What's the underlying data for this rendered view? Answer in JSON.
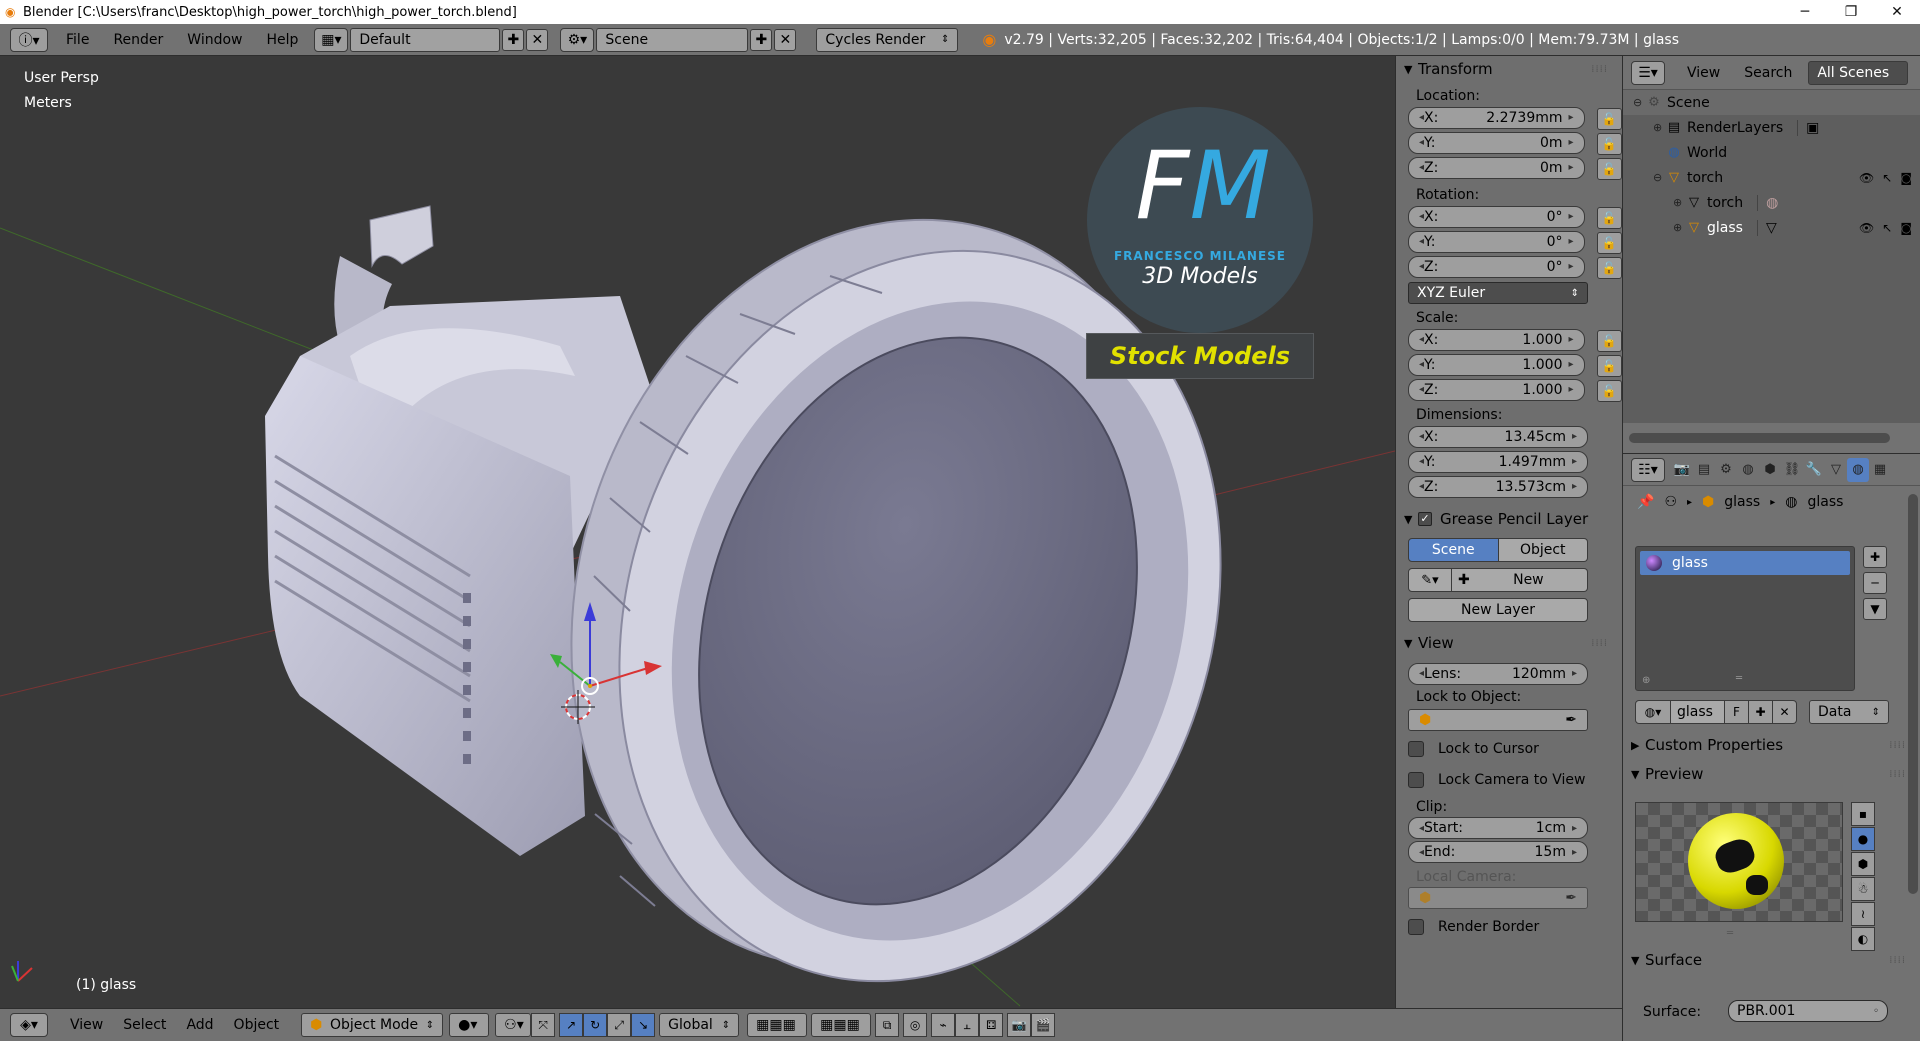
{
  "window": {
    "title": "Blender [C:\\Users\\franc\\Desktop\\high_power_torch\\high_power_torch.blend]",
    "minimize": "─",
    "maximize": "❐",
    "close": "✕"
  },
  "info_header": {
    "menus": [
      "File",
      "Render",
      "Window",
      "Help"
    ],
    "screen_layout": "Default",
    "scene": "Scene",
    "render_engine": "Cycles Render",
    "stats": "v2.79 | Verts:32,205 | Faces:32,202 | Tris:64,404 | Objects:1/2 | Lamps:0/0 | Mem:79.73M | glass"
  },
  "viewport": {
    "view_name": "User Persp",
    "units": "Meters",
    "object_label": "(1) glass",
    "watermark": {
      "logo": "FM",
      "name": "FRANCESCO MILANESE",
      "sub": "3D Models",
      "banner": "Stock Models"
    }
  },
  "transform": {
    "header": "Transform",
    "location_label": "Location:",
    "location": [
      {
        "axis": "X:",
        "value": "2.2739mm"
      },
      {
        "axis": "Y:",
        "value": "0m"
      },
      {
        "axis": "Z:",
        "value": "0m"
      }
    ],
    "rotation_label": "Rotation:",
    "rotation": [
      {
        "axis": "X:",
        "value": "0°"
      },
      {
        "axis": "Y:",
        "value": "0°"
      },
      {
        "axis": "Z:",
        "value": "0°"
      }
    ],
    "rotation_mode": "XYZ Euler",
    "scale_label": "Scale:",
    "scale": [
      {
        "axis": "X:",
        "value": "1.000"
      },
      {
        "axis": "Y:",
        "value": "1.000"
      },
      {
        "axis": "Z:",
        "value": "1.000"
      }
    ],
    "dimensions_label": "Dimensions:",
    "dimensions": [
      {
        "axis": "X:",
        "value": "13.45cm"
      },
      {
        "axis": "Y:",
        "value": "1.497mm"
      },
      {
        "axis": "Z:",
        "value": "13.573cm"
      }
    ]
  },
  "grease_pencil": {
    "header": "Grease Pencil Layer",
    "tab_scene": "Scene",
    "tab_object": "Object",
    "new": "New",
    "new_layer": "New Layer"
  },
  "view_panel": {
    "header": "View",
    "lens_label": "Lens:",
    "lens_value": "120mm",
    "lock_to_object": "Lock to Object:",
    "lock_to_cursor": "Lock to Cursor",
    "lock_camera": "Lock Camera to View",
    "clip": "Clip:",
    "clip_start_label": "Start:",
    "clip_start": "1cm",
    "clip_end_label": "End:",
    "clip_end": "15m",
    "local_camera": "Local Camera:",
    "render_border": "Render Border"
  },
  "outliner": {
    "menu_view": "View",
    "menu_search": "Search",
    "filter": "All Scenes",
    "items": [
      {
        "label": "Scene",
        "icon": "scene-icon"
      },
      {
        "label": "RenderLayers",
        "icon": "renderlayers-icon"
      },
      {
        "label": "World",
        "icon": "world-icon"
      },
      {
        "label": "torch",
        "icon": "object-icon"
      },
      {
        "label": "torch",
        "icon": "mesh-icon"
      },
      {
        "label": "glass",
        "icon": "object-icon"
      }
    ]
  },
  "properties": {
    "crumb_object": "glass",
    "crumb_material": "glass",
    "material_slot": "glass",
    "material_name": "glass",
    "fake_user": "F",
    "link": "Data",
    "custom_properties": "Custom Properties",
    "preview": "Preview",
    "surface_header": "Surface",
    "surface_label": "Surface:",
    "surface_value": "PBR.001"
  },
  "bottom_bar": {
    "menus": [
      "View",
      "Select",
      "Add",
      "Object"
    ],
    "mode": "Object Mode",
    "orientation": "Global"
  },
  "colors": {
    "selection_blue": "#5680c2",
    "header_gray": "#727272",
    "viewport_bg": "#393939",
    "banner_text": "#e1e100"
  }
}
